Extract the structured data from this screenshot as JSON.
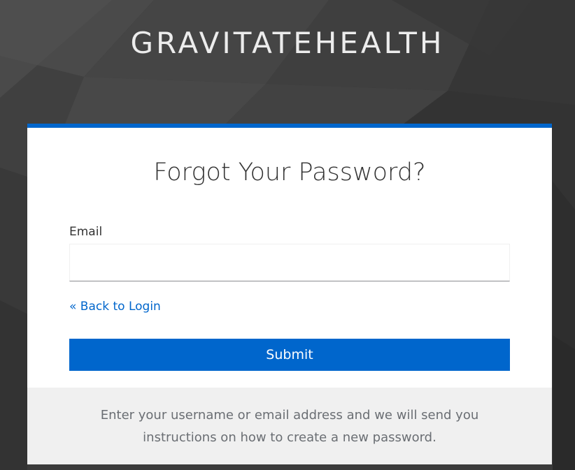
{
  "brand": {
    "title": "GRAVITATEHEALTH"
  },
  "card": {
    "title": "Forgot Your Password?",
    "email_label": "Email",
    "email_value": "",
    "email_placeholder": "",
    "back_link": "« Back to Login",
    "submit_label": "Submit",
    "info_text": "Enter your username or email address and we will send you instructions on how to create a new password."
  },
  "colors": {
    "accent": "#0066cc",
    "background": "#3a3a3a",
    "card": "#ffffff",
    "info_box": "#f0f0f0"
  }
}
